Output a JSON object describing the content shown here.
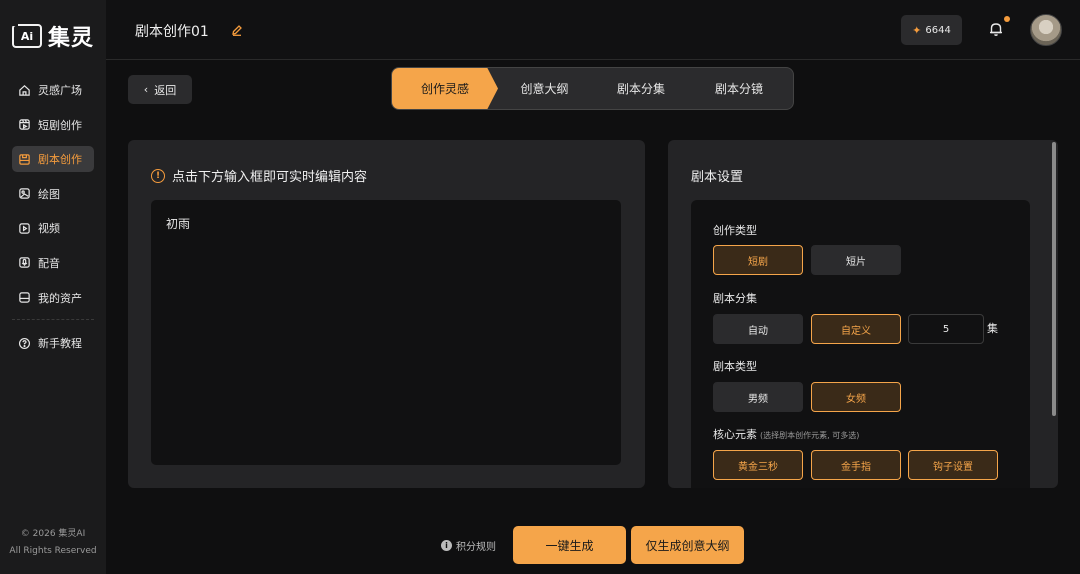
{
  "app": {
    "logo_mark": "Ai",
    "logo_name": "集灵"
  },
  "sidebar": {
    "items": [
      {
        "label": "灵感广场",
        "icon": "home-icon"
      },
      {
        "label": "短剧创作",
        "icon": "film-icon"
      },
      {
        "label": "剧本创作",
        "icon": "script-icon",
        "active": true
      },
      {
        "label": "绘图",
        "icon": "image-icon"
      },
      {
        "label": "视频",
        "icon": "play-icon"
      },
      {
        "label": "配音",
        "icon": "mic-icon"
      },
      {
        "label": "我的资产",
        "icon": "folder-icon"
      }
    ],
    "help": {
      "label": "新手教程",
      "icon": "question-icon"
    },
    "copyright": "© 2026 集灵AI",
    "rights": "All Rights Reserved"
  },
  "header": {
    "title": "剧本创作01",
    "points": "6644",
    "accent": "#f5a54a"
  },
  "back_label": "返回",
  "steps": [
    "创作灵感",
    "创意大纲",
    "剧本分集",
    "剧本分镜"
  ],
  "editor": {
    "hint": "点击下方输入框即可实时编辑内容",
    "content": "初雨"
  },
  "settings": {
    "title": "剧本设置",
    "creation_type": {
      "label": "创作类型",
      "options": [
        "短剧",
        "短片"
      ],
      "selected": "短剧"
    },
    "episodes": {
      "label": "剧本分集",
      "options": [
        "自动",
        "自定义"
      ],
      "selected": "自定义",
      "count": "5",
      "unit": "集"
    },
    "script_type": {
      "label": "剧本类型",
      "options": [
        "男频",
        "女频"
      ],
      "selected": "女频"
    },
    "core_elements": {
      "label": "核心元素",
      "note": "(选择剧本创作元素, 可多选)",
      "options": [
        "黄金三秒",
        "金手指",
        "钩子设置"
      ]
    }
  },
  "actions": {
    "rules": "积分规则",
    "generate": "一键生成",
    "outline_only": "仅生成创意大纲"
  }
}
